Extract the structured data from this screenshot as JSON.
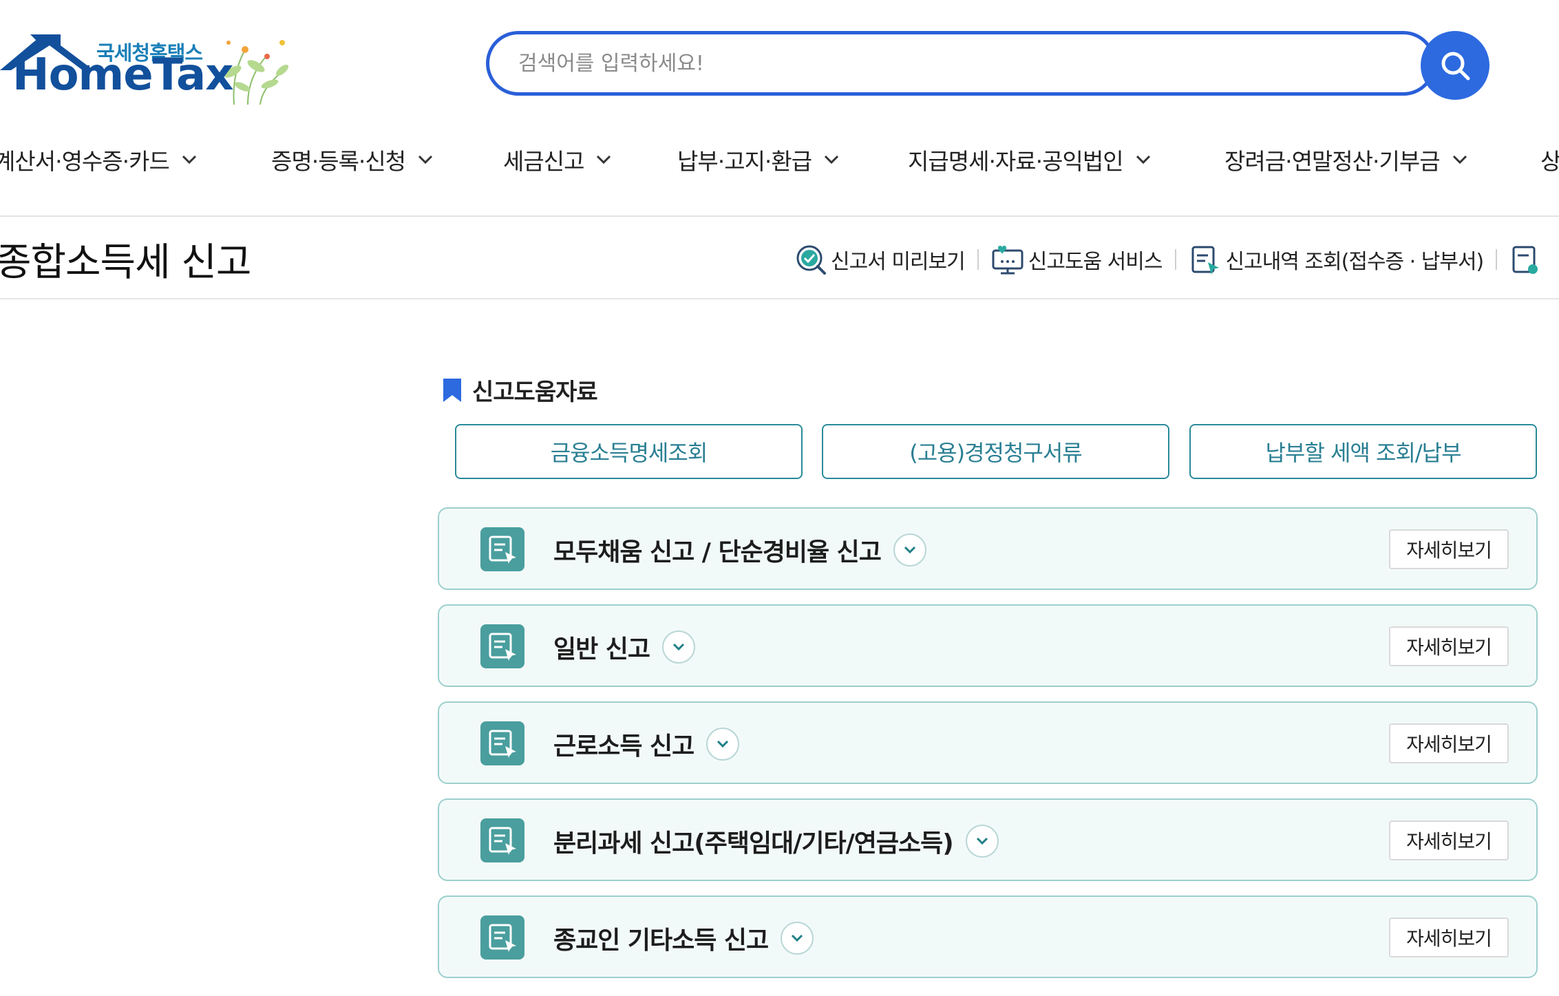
{
  "logo": {
    "subtitle": "국세청홈택스",
    "wordmark": "HomeTax"
  },
  "search": {
    "placeholder": "검색어를 입력하세요!",
    "value": "",
    "button_icon": "search-icon"
  },
  "nav": {
    "items": [
      {
        "label": "계산서·영수증·카드"
      },
      {
        "label": "증명·등록·신청"
      },
      {
        "label": "세금신고"
      },
      {
        "label": "납부·고지·환급"
      },
      {
        "label": "지급명세·자료·공익법인"
      },
      {
        "label": "장려금·연말정산·기부금"
      },
      {
        "label": "상"
      }
    ]
  },
  "page": {
    "title": "종합소득세 신고"
  },
  "quick_links": [
    {
      "label": "신고서 미리보기",
      "icon": "preview-check-icon"
    },
    {
      "label": "신고도움 서비스",
      "icon": "help-monitor-icon"
    },
    {
      "label": "신고내역 조회(접수증 · 납부서)",
      "icon": "history-document-icon"
    }
  ],
  "section": {
    "heading": "신고도움자료",
    "heading_icon": "bookmark-icon",
    "help_buttons": [
      {
        "label": "금융소득명세조회"
      },
      {
        "label": "(고용)경정청구서류"
      },
      {
        "label": "납부할 세액 조회/납부"
      }
    ]
  },
  "filing_types": [
    {
      "title": "모두채움 신고 / 단순경비율 신고",
      "detail_label": "자세히보기"
    },
    {
      "title": "일반 신고",
      "detail_label": "자세히보기"
    },
    {
      "title": "근로소득 신고",
      "detail_label": "자세히보기"
    },
    {
      "title": "분리과세 신고(주택임대/기타/연금소득)",
      "detail_label": "자세히보기"
    },
    {
      "title": "종교인 기타소득 신고",
      "detail_label": "자세히보기"
    }
  ],
  "colors": {
    "brand_blue": "#2d6ae0",
    "logo_navy": "#12509c",
    "teal_accent": "#2a7f93",
    "card_background": "#f2faf9",
    "card_border": "#9ccfcc"
  }
}
